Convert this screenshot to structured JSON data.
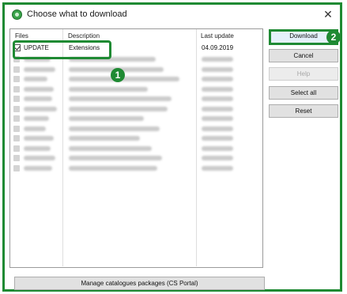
{
  "window": {
    "title": "Choose what to download",
    "close_glyph": "✕",
    "app_icon": "app-icon"
  },
  "list": {
    "columns": [
      "Files",
      "Description",
      "Last update"
    ],
    "visible_row": {
      "checked": true,
      "file": "UPDATE",
      "description": "Extensions",
      "last_update": "04.09.2019"
    },
    "redacted_row_count": 12
  },
  "buttons": {
    "download": "Download",
    "cancel": "Cancel",
    "help": "Help",
    "select_all": "Select all",
    "reset": "Reset",
    "manage": "Manage catalogues packages (CS Portal)"
  },
  "annotations": {
    "marker_1": "1",
    "marker_2": "2",
    "highlight_color": "#1f8a33"
  }
}
